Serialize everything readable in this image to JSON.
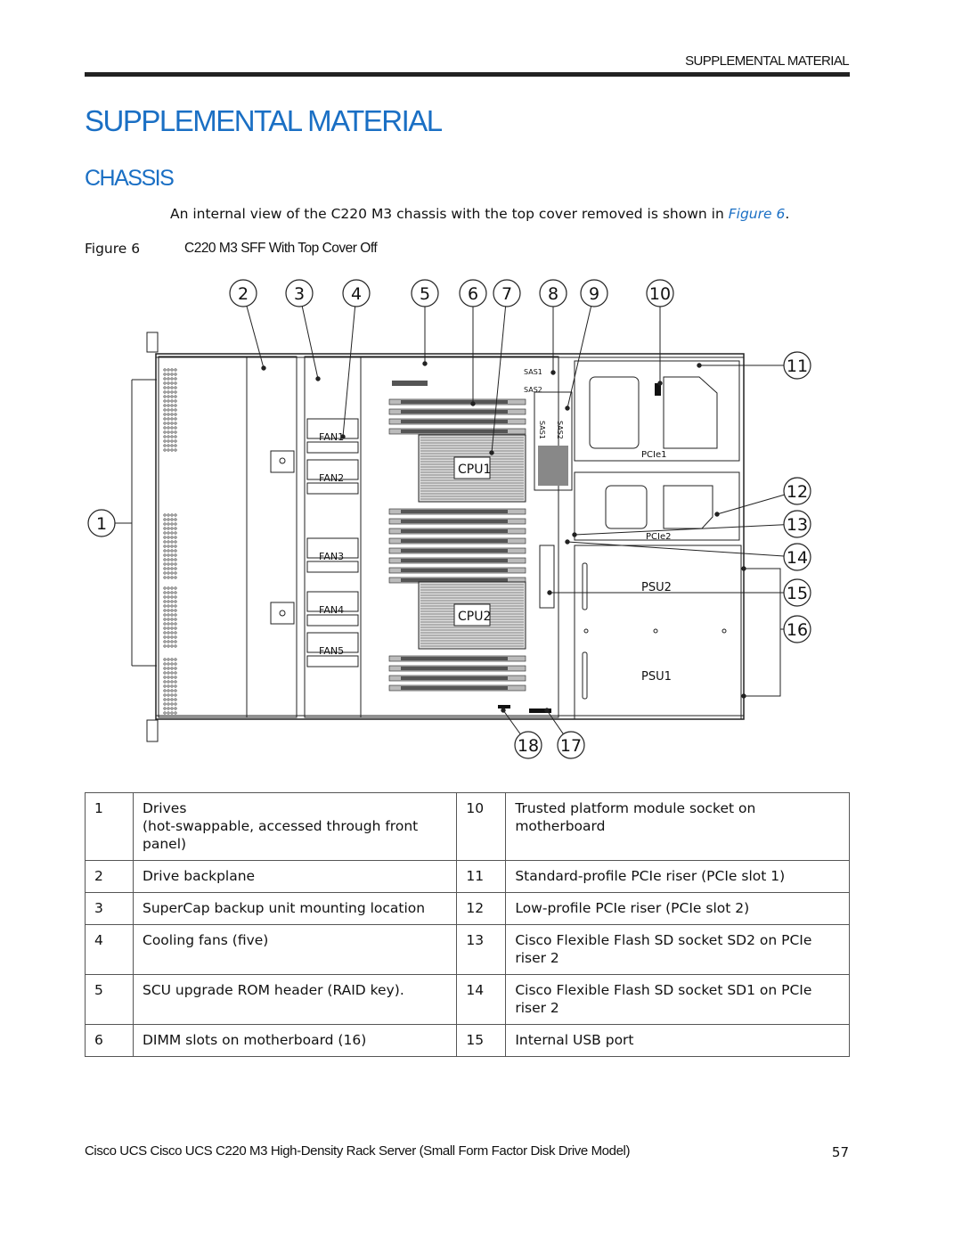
{
  "header": {
    "running_head": "SUPPLEMENTAL MATERIAL"
  },
  "title": "SUPPLEMENTAL MATERIAL",
  "section": "CHASSIS",
  "intro": {
    "text_before": "An internal view of the C220 M3 chassis with the top cover removed is shown in ",
    "link": "Figure 6",
    "text_after": "."
  },
  "figure": {
    "label": "Figure 6",
    "caption": "C220 M3 SFF With Top Cover Off",
    "component_labels": {
      "fan1": "FAN1",
      "fan2": "FAN2",
      "fan3": "FAN3",
      "fan4": "FAN4",
      "fan5": "FAN5",
      "cpu1": "CPU1",
      "cpu2": "CPU2",
      "psu1": "PSU1",
      "psu2": "PSU2",
      "pcie1": "PCIe1",
      "pcie2": "PCIe2",
      "sas1": "SAS1",
      "sas2": "SAS2",
      "sas1_v": "SAS1",
      "sas2_v": "SAS2"
    },
    "callouts": [
      "1",
      "2",
      "3",
      "4",
      "5",
      "6",
      "7",
      "8",
      "9",
      "10",
      "11",
      "12",
      "13",
      "14",
      "15",
      "16",
      "17",
      "18"
    ]
  },
  "legend_table": {
    "rows": [
      {
        "n1": "1",
        "d1": "Drives\n(hot-swappable, accessed through front panel)",
        "n2": "10",
        "d2": "Trusted platform module socket on motherboard"
      },
      {
        "n1": "2",
        "d1": "Drive backplane",
        "n2": "11",
        "d2": "Standard-profile PCIe riser (PCIe slot 1)"
      },
      {
        "n1": "3",
        "d1": "SuperCap backup unit mounting location",
        "n2": "12",
        "d2": "Low-profile PCIe riser (PCIe slot 2)"
      },
      {
        "n1": "4",
        "d1": "Cooling fans (five)",
        "n2": "13",
        "d2": "Cisco Flexible Flash SD socket SD2 on PCIe riser 2"
      },
      {
        "n1": "5",
        "d1": "SCU upgrade ROM header (RAID key).",
        "n2": "14",
        "d2": "Cisco Flexible Flash SD socket SD1 on PCIe riser 2"
      },
      {
        "n1": "6",
        "d1": "DIMM slots on motherboard (16)",
        "n2": "15",
        "d2": "Internal USB port"
      }
    ]
  },
  "footer": {
    "text": "Cisco UCS Cisco UCS C220 M3 High-Density Rack Server (Small Form Factor Disk Drive Model)",
    "page": "57"
  },
  "colors": {
    "heading": "#1a6fc4",
    "rule": "#222222"
  }
}
